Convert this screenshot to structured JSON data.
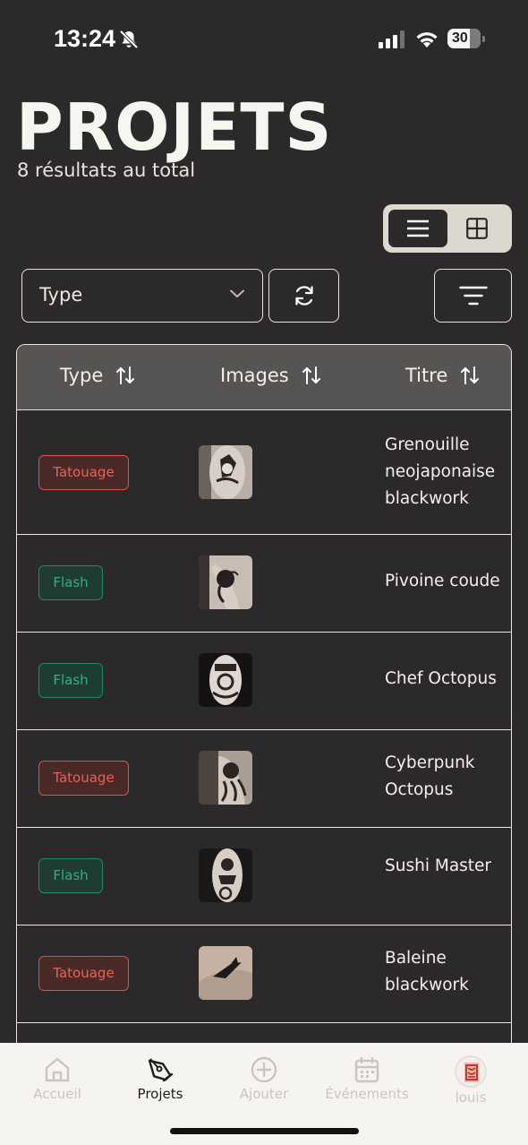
{
  "status_bar": {
    "time": "13:24",
    "battery": "30"
  },
  "header": {
    "title": "PROJETS",
    "subtitle": "8 résultats au total"
  },
  "filters": {
    "type_select_label": "Type"
  },
  "table": {
    "columns": [
      "Type",
      "Images",
      "Titre"
    ],
    "rows": [
      {
        "type": "Tatouage",
        "title": "Grenouille neojaponaise blackwork"
      },
      {
        "type": "Flash",
        "title": "Pivoine coude"
      },
      {
        "type": "Flash",
        "title": "Chef Octopus"
      },
      {
        "type": "Tatouage",
        "title": "Cyberpunk Octopus"
      },
      {
        "type": "Flash",
        "title": "Sushi Master"
      },
      {
        "type": "Tatouage",
        "title": "Baleine blackwork"
      }
    ]
  },
  "tab_bar": {
    "tabs": [
      {
        "label": "Accueil",
        "icon": "home-icon",
        "active": false
      },
      {
        "label": "Projets",
        "icon": "pen-nib-icon",
        "active": true
      },
      {
        "label": "Ajouter",
        "icon": "plus-circle-icon",
        "active": false
      },
      {
        "label": "Événements",
        "icon": "calendar-icon",
        "active": false
      },
      {
        "label": "louis",
        "icon": "avatar",
        "active": false
      }
    ]
  },
  "colors": {
    "background": "#2b2929",
    "tatouage_badge": "#e46359",
    "flash_badge": "#2fb27f",
    "tab_bar": "#f6f4f1"
  }
}
